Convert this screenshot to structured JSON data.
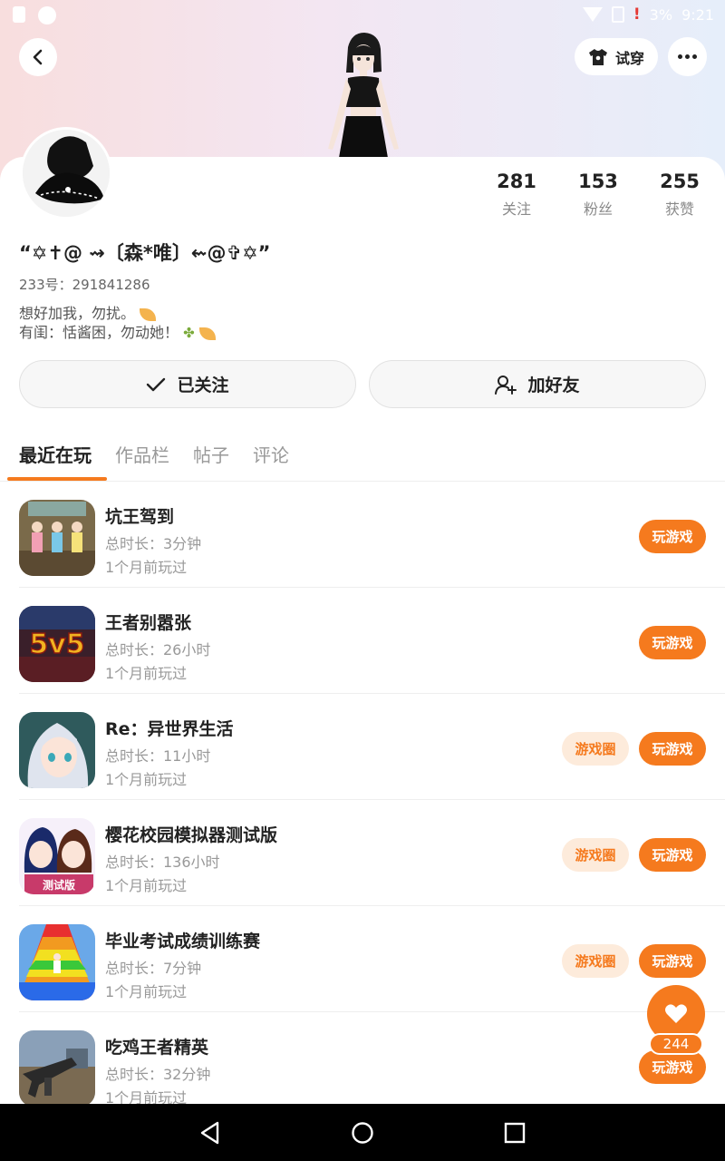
{
  "status_bar": {
    "battery": "3%",
    "time": "9:21",
    "alert": "!"
  },
  "toolbar": {
    "tryon_label": "试穿"
  },
  "profile": {
    "nickname": "“✡✝@ ⇝〔森*唯〕⇜@✞✡”",
    "uid": "233号：291841286",
    "bio_line1": "想好加我，勿扰。",
    "bio_line2": "有闺：恬酱困，勿动她！",
    "stats": [
      {
        "num": "281",
        "label": "关注"
      },
      {
        "num": "153",
        "label": "粉丝"
      },
      {
        "num": "255",
        "label": "获赞"
      }
    ]
  },
  "actions": {
    "follow_label": "已关注",
    "add_friend_label": "加好友"
  },
  "tabs": [
    "最近在玩",
    "作品栏",
    "帖子",
    "评论"
  ],
  "games": [
    {
      "title": "坑王驾到",
      "duration": "总时长：3分钟",
      "last_played": "1个月前玩过",
      "circle": "",
      "play": "玩游戏",
      "icon": "girls-icon"
    },
    {
      "title": "王者别嚣张",
      "duration": "总时长：26小时",
      "last_played": "1个月前玩过",
      "circle": "",
      "play": "玩游戏",
      "icon": "5v5-icon"
    },
    {
      "title": "Re：异世界生活",
      "duration": "总时长：11小时",
      "last_played": "1个月前玩过",
      "circle": "游戏圈",
      "play": "玩游戏",
      "icon": "anime-girl-icon"
    },
    {
      "title": "樱花校园模拟器测试版",
      "duration": "总时长：136小时",
      "last_played": "1个月前玩过",
      "circle": "游戏圈",
      "play": "玩游戏",
      "icon": "sakura-icon"
    },
    {
      "title": "毕业考试成绩训练赛",
      "duration": "总时长：7分钟",
      "last_played": "1个月前玩过",
      "circle": "游戏圈",
      "play": "玩游戏",
      "icon": "rainbow-stairs-icon"
    },
    {
      "title": "吃鸡王者精英",
      "duration": "总时长：32分钟",
      "last_played": "1个月前玩过",
      "circle": "",
      "play": "玩游戏",
      "icon": "gun-icon"
    }
  ],
  "like": {
    "count": "244"
  },
  "colors": {
    "accent": "#f57a1e",
    "accent_light": "#fdebdb"
  }
}
